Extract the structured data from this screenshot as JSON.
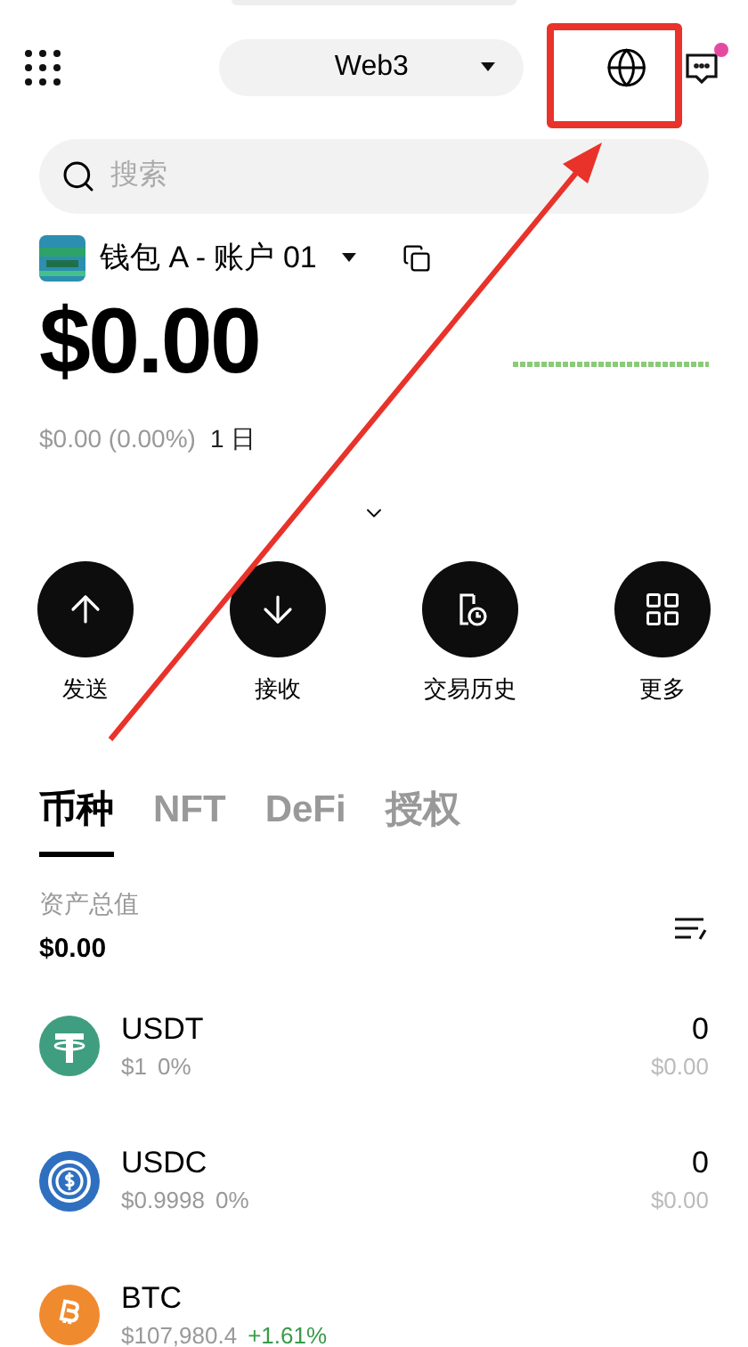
{
  "header": {
    "network": "Web3",
    "messages_unread": true
  },
  "search": {
    "placeholder": "搜索"
  },
  "wallet": {
    "name": "钱包 A - 账户 01",
    "balance": "$0.00",
    "change": "$0.00 (0.00%)",
    "period": "1 日"
  },
  "actions": [
    {
      "kind": "send",
      "label": "发送"
    },
    {
      "kind": "receive",
      "label": "接收"
    },
    {
      "kind": "history",
      "label": "交易历史"
    },
    {
      "kind": "more",
      "label": "更多"
    }
  ],
  "tabs": [
    {
      "label": "币种",
      "selected": true
    },
    {
      "label": "NFT",
      "selected": false
    },
    {
      "label": "DeFi",
      "selected": false
    },
    {
      "label": "授权",
      "selected": false
    }
  ],
  "total": {
    "label": "资产总值",
    "value": "$0.00"
  },
  "assets": [
    {
      "kind": "usdt",
      "symbol": "USDT",
      "price": "$1",
      "change": "0%",
      "color": "#999999",
      "amount": "0",
      "value": "$0.00"
    },
    {
      "kind": "usdc",
      "symbol": "USDC",
      "price": "$0.9998",
      "change": "0%",
      "color": "#999999",
      "amount": "0",
      "value": "$0.00"
    },
    {
      "kind": "btc",
      "symbol": "BTC",
      "price": "$107,980.4",
      "change": "+1.61%",
      "color": "#3a9a4a"
    }
  ]
}
